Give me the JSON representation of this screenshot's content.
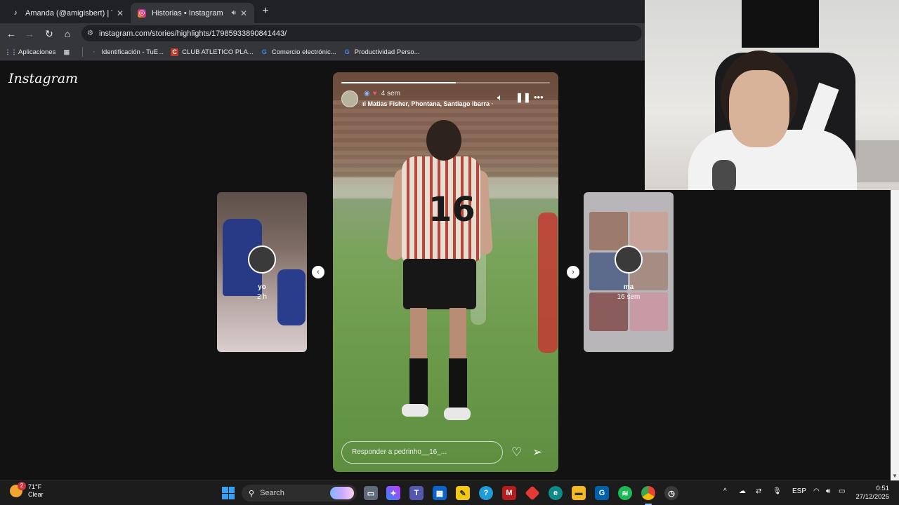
{
  "browser": {
    "tabs": [
      {
        "title": "Amanda (@amigisbert) | TikTok",
        "active": false
      },
      {
        "title": "Historias • Instagram",
        "active": true
      }
    ],
    "new_tab_label": "+",
    "url": "instagram.com/stories/highlights/17985933890841443/"
  },
  "bookmarks": [
    {
      "label": "Aplicaciones",
      "icon": "apps-grid-icon"
    },
    {
      "label": "Identificación - TuE...",
      "icon": "page-icon"
    },
    {
      "label": "CLUB ATLETICO PLA...",
      "icon": "club-logo-icon"
    },
    {
      "label": "Comercio electrónic...",
      "icon": "google-icon"
    },
    {
      "label": "Productividad Perso...",
      "icon": "google-icon"
    }
  ],
  "instagram": {
    "logo": "Instagram",
    "main_story": {
      "time": "4 sem",
      "music": "Matias Fisher, Phontana, Santiago Ibarra ·",
      "reply_placeholder": "Responder a pedrinho__16_...",
      "progress": 0.55,
      "jersey_number": "16"
    },
    "prev_story": {
      "name": "yo",
      "time": "2 h"
    },
    "next_story": {
      "name": "ma",
      "time": "16 sem"
    }
  },
  "taskbar": {
    "weather_temp": "71°F",
    "weather_desc": "Clear",
    "weather_badge": "2",
    "search_label": "Search",
    "language": "ESP",
    "time": "0:51",
    "date": "27/12/2025"
  },
  "colors": {
    "chrome_dark": "#202124",
    "chrome_toolbar": "#35363a",
    "ig_background": "#121212",
    "windows_accent": "#3aa0f3"
  }
}
